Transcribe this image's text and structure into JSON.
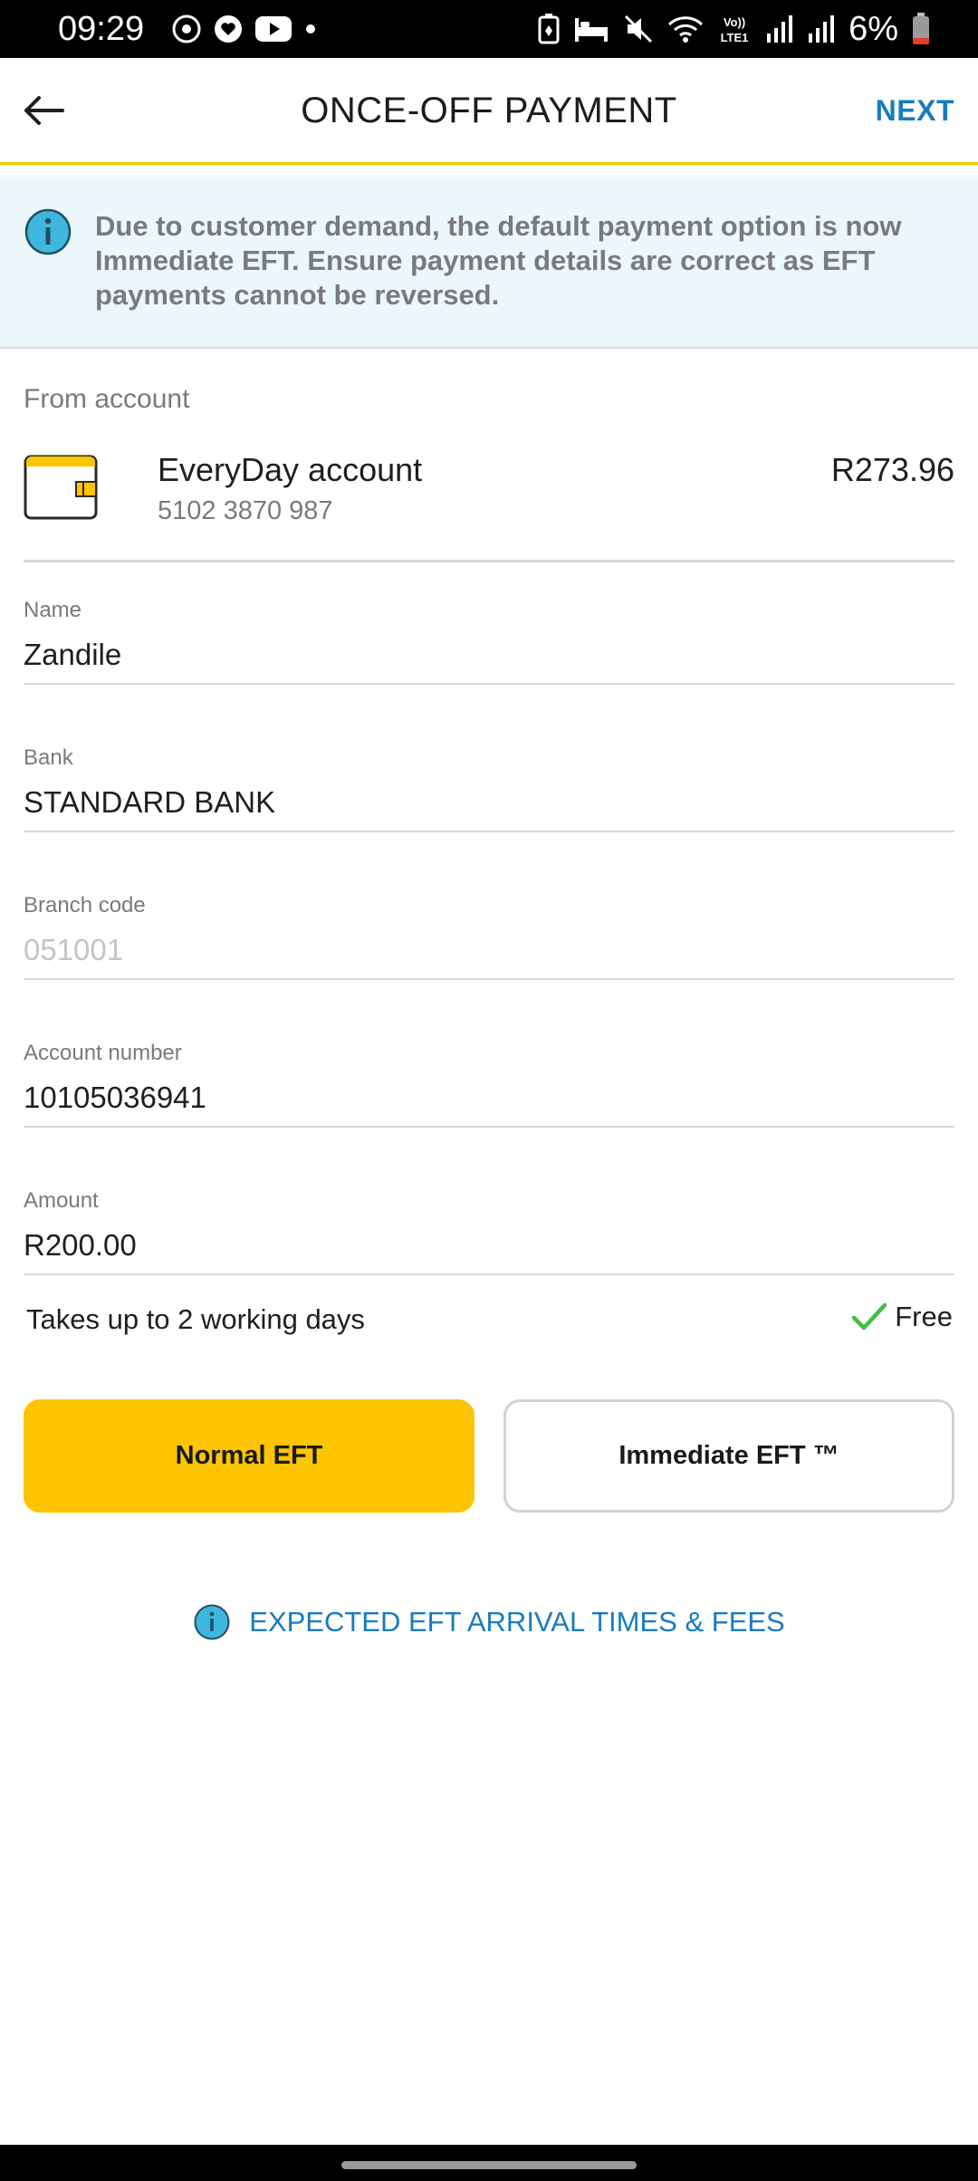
{
  "status_bar": {
    "time": "09:29",
    "battery": "6%",
    "icons": [
      "threads-icon",
      "heart-chat-icon",
      "youtube-icon",
      "dot-icon",
      "battery-saver-icon",
      "bed-icon",
      "mute-icon",
      "wifi-icon",
      "volte-icon",
      "signal-icon",
      "signal-icon",
      "battery-icon"
    ]
  },
  "header": {
    "title": "ONCE-OFF PAYMENT",
    "next_label": "NEXT",
    "back_icon": "back-arrow-icon"
  },
  "banner": {
    "text": "Due to customer demand, the default payment option is now Immediate EFT. Ensure payment details are correct as EFT payments cannot be reversed."
  },
  "from_account": {
    "label": "From account",
    "name": "EveryDay account",
    "number": "5102 3870 987",
    "balance": "R273.96"
  },
  "fields": {
    "name": {
      "label": "Name",
      "value": "Zandile"
    },
    "bank": {
      "label": "Bank",
      "value": "STANDARD BANK"
    },
    "branch_code": {
      "label": "Branch code",
      "value": "051001"
    },
    "account_number": {
      "label": "Account number",
      "value": "10105036941"
    },
    "amount": {
      "label": "Amount",
      "value": "R200.00"
    }
  },
  "timing": {
    "text": "Takes up to 2 working days",
    "fee": "Free"
  },
  "eft_options": {
    "normal": "Normal EFT",
    "immediate": "Immediate EFT ™"
  },
  "link": {
    "text": "EXPECTED EFT ARRIVAL TIMES & FEES"
  },
  "colors": {
    "accent_yellow": "#fcc500",
    "link_blue": "#1a7bbf",
    "info_bg": "#ebf7fb",
    "info_icon": "#3fb6de",
    "check_green": "#3fbf3f"
  }
}
